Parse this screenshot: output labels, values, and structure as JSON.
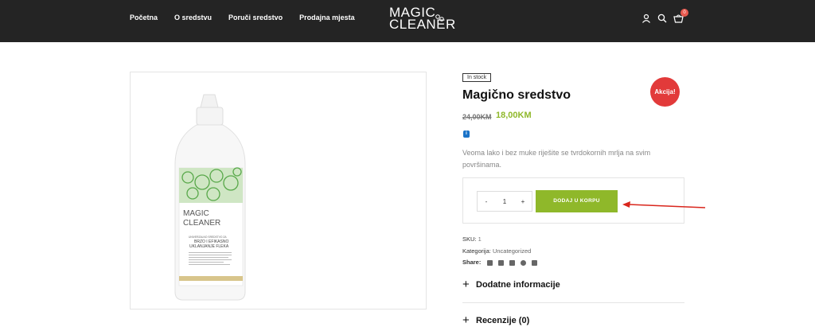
{
  "nav": {
    "items": [
      "Početna",
      "O sredstvu",
      "Poruči sredstvo",
      "Prodajna mjesta"
    ]
  },
  "logo": {
    "line1": "MAGIC",
    "line2": "CLEANER"
  },
  "header_icons": {
    "user": "user-icon",
    "search": "search-icon",
    "cart": "cart-icon",
    "cart_count": "0"
  },
  "product": {
    "stock": "In stock",
    "title": "Magično sredstvo",
    "sale_badge": "Akcija!",
    "price_old": "24,00KM",
    "price_new": "18,00KM",
    "description": "Veoma lako i bez muke riješite se tvrdokornih mrlja na svim površinama.",
    "qty": {
      "minus": "-",
      "value": "1",
      "plus": "+"
    },
    "add_to_cart": "DODAJ U KORPU",
    "sku_label": "SKU:",
    "sku_value": "1",
    "category_label": "Kategorija:",
    "category_value": "Uncategorized",
    "share_label": "Share:",
    "share_icons": [
      "facebook-icon",
      "twitter-icon",
      "linkedin-icon",
      "pinterest-icon",
      "mail-icon"
    ]
  },
  "accordion": {
    "additional": "Dodatne informacije",
    "reviews": "Recenzije (0)"
  },
  "bottle_label": {
    "brand1": "MAGIC",
    "brand2": "CLEANER",
    "line1": "UNIVERZALNO SREDSTVO ZA",
    "line2": "BRZO I EFIKASNO",
    "line3": "UKLANJANJE FLEKA"
  },
  "colors": {
    "accent": "#8fb82a",
    "sale": "#e23a3a",
    "header": "#242424",
    "arrow": "#d9261c"
  }
}
